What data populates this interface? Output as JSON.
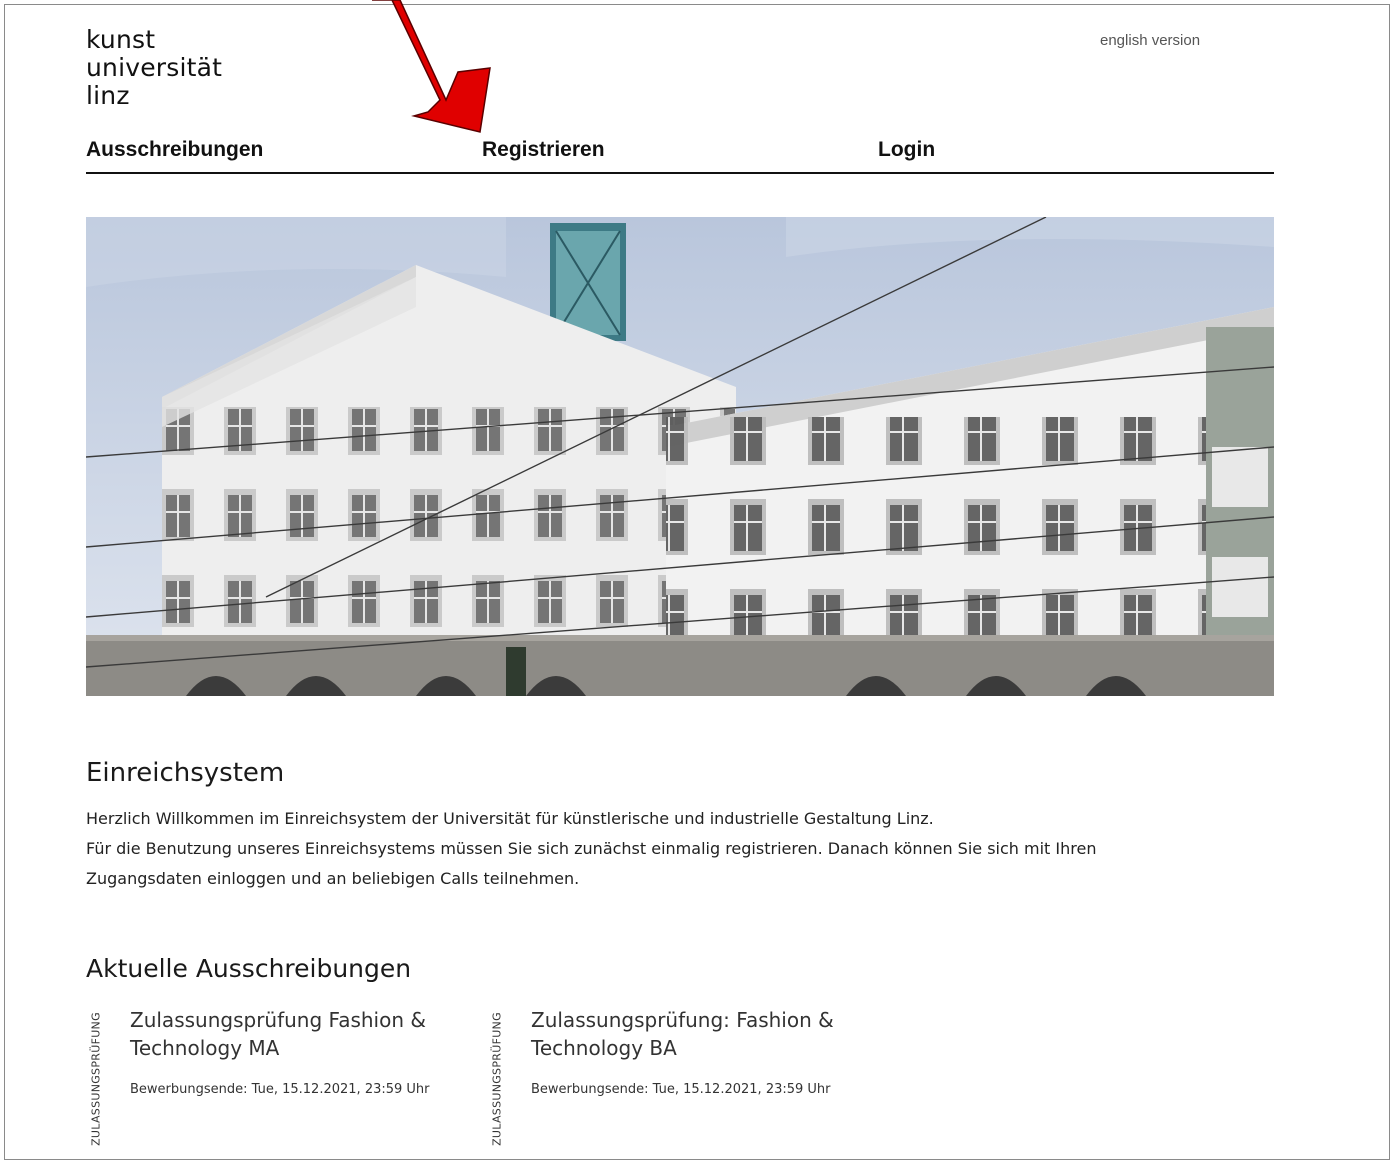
{
  "logo": {
    "line1": "kunst",
    "line2": "universität",
    "line3": "linz"
  },
  "header": {
    "language_link": "english version"
  },
  "nav": [
    {
      "label": "Ausschreibungen"
    },
    {
      "label": "Registrieren"
    },
    {
      "label": "Login"
    }
  ],
  "hero": {
    "image": "university building photo"
  },
  "intro": {
    "title": "Einreichsystem",
    "line1": "Herzlich Willkommen im Einreichsystem der Universität für künstlerische und industrielle Gestaltung Linz.",
    "line2": "Für die Benutzung unseres Einreichsystems müssen Sie sich zunächst einmalig registrieren. Danach können Sie sich mit Ihren Zugangsdaten einloggen und an beliebigen Calls teilnehmen."
  },
  "calls": {
    "title": "Aktuelle Ausschreibungen",
    "items": [
      {
        "category": "ZULASSUNGSPRÜFUNG",
        "title": "Zulassungsprüfung Fashion & Technology MA",
        "deadline": "Bewerbungsende: Tue, 15.12.2021, 23:59 Uhr"
      },
      {
        "category": "ZULASSUNGSPRÜFUNG",
        "title": "Zulassungsprüfung: Fashion & Technology BA",
        "deadline": "Bewerbungsende: Tue, 15.12.2021, 23:59 Uhr"
      }
    ]
  },
  "annotation": {
    "arrow_color": "#e00000",
    "icon": "red-arrow-pointer"
  }
}
